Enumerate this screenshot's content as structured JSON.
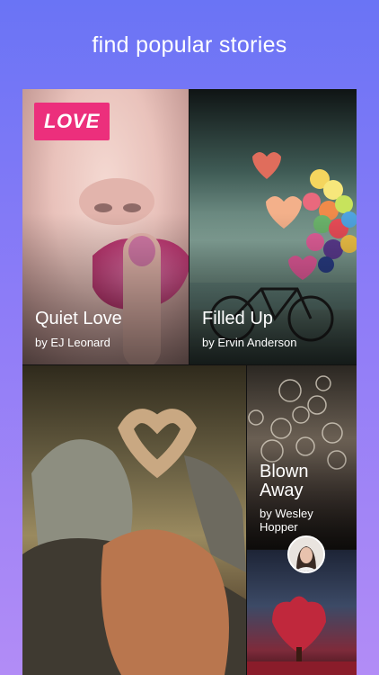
{
  "header": {
    "headline": "find popular stories"
  },
  "stories": [
    {
      "title": "Quiet Love",
      "author": "by EJ Leonard",
      "badge": "LOVE"
    },
    {
      "title": "Filled Up",
      "author": "by Ervin Anderson"
    },
    {
      "title": "",
      "author": ""
    },
    {
      "title": "Blown Away",
      "author": "by Wesley Hopper"
    },
    {
      "title": "",
      "author": ""
    }
  ],
  "colors": {
    "badge": "#ec2f7c",
    "bg_top": "#6a74f5",
    "bg_bottom": "#b28cf6"
  }
}
